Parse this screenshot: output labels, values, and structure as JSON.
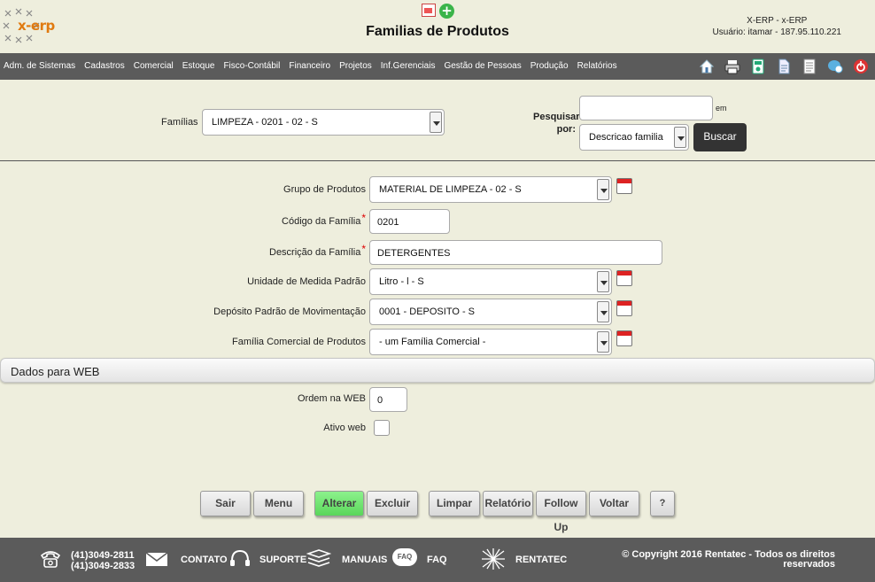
{
  "header": {
    "logo_text": "x-erp",
    "page_title": "Familias de Produtos",
    "system_line": "X-ERP - x-ERP",
    "user_line": "Usuário: itamar - 187.95.110.221"
  },
  "menu": {
    "items": [
      "Adm. de Sistemas",
      "Cadastros",
      "Comercial",
      "Estoque",
      "Fisco-Contábil",
      "Financeiro",
      "Projetos",
      "Inf.Gerenciais",
      "Gestão de Pessoas",
      "Produção",
      "Relatórios"
    ]
  },
  "search": {
    "familias_label": "Famílias",
    "familias_value": "LIMPEZA - 0201 - 02 - S",
    "pesquisar_label_1": "Pesquisar",
    "pesquisar_label_2": "por:",
    "search_value": "",
    "em_label": "em",
    "field_value": "Descricao familia",
    "buscar_label": "Buscar"
  },
  "form": {
    "grupo_label": "Grupo de Produtos",
    "grupo_value": "MATERIAL DE LIMPEZA - 02 - S",
    "codigo_label": "Código da Família",
    "codigo_value": "0201",
    "descricao_label": "Descrição da Família",
    "descricao_value": "DETERGENTES",
    "unidade_label": "Unidade de Medida Padrão",
    "unidade_value": "Litro - l - S",
    "deposito_label": "Depósito Padrão de Movimentação",
    "deposito_value": "0001 - DEPOSITO - S",
    "comercial_label": "Família Comercial de Produtos",
    "comercial_value": "- um Família Comercial -",
    "required_mark": "*"
  },
  "web": {
    "section_title": "Dados para WEB",
    "ordem_label": "Ordem na WEB",
    "ordem_value": "0",
    "ativo_label": "Ativo web",
    "ativo_checked": false
  },
  "buttons": {
    "sair": "Sair",
    "menu": "Menu",
    "alterar": "Alterar",
    "excluir": "Excluir",
    "limpar": "Limpar",
    "relatorio": "Relatório",
    "followup": "Follow Up",
    "voltar": "Voltar",
    "help": "?"
  },
  "footer": {
    "phone1": "(41)3049-2811",
    "phone2": "(41)3049-2833",
    "contato": "CONTATO",
    "suporte": "SUPORTE",
    "manuais": "MANUAIS",
    "faq_badge": "FAQ",
    "faq": "FAQ",
    "rentatec": "RENTATEC",
    "copyright_1": "© Copyright 2016 Rentatec - Todos os direitos",
    "copyright_2": "reservados"
  },
  "colors": {
    "menubar": "#5b5b5b",
    "background": "#eeeedd",
    "logo_orange": "#e07a10",
    "alterar_green": "#6de06d"
  }
}
